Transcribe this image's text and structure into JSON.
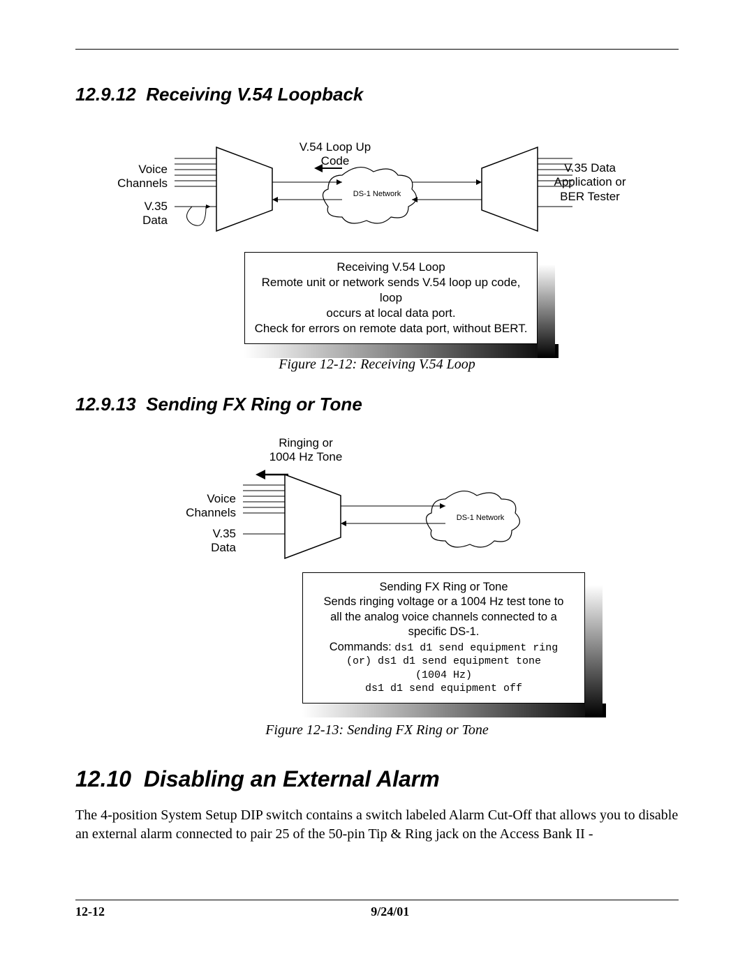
{
  "sections": {
    "s1_num": "12.9.12",
    "s1_title": "Receiving V.54 Loopback",
    "s2_num": "12.9.13",
    "s2_title": "Sending FX Ring or Tone",
    "h1_num": "12.10",
    "h1_title": "Disabling an External Alarm"
  },
  "fig1": {
    "caption": "Figure 12-12: Receiving V.54 Loop",
    "labels": {
      "voice": "Voice",
      "channels": "Channels",
      "v35": "V.35",
      "data": "Data",
      "loopup1": "V.54 Loop Up",
      "loopup2": "Code",
      "cloud": "DS-1 Network",
      "right1": "V.35 Data",
      "right2": "Application or",
      "right3": "BER Tester"
    },
    "box": {
      "l1": "Receiving V.54 Loop",
      "l2": "Remote unit or network sends V.54 loop up code, loop",
      "l3": "occurs at local data port.",
      "l4": "Check for errors on remote data port, without BERT."
    }
  },
  "fig2": {
    "caption": "Figure 12-13: Sending FX Ring or Tone",
    "labels": {
      "ring1": "Ringing or",
      "ring2": "1004 Hz Tone",
      "voice": "Voice",
      "channels": "Channels",
      "v35": "V.35",
      "data": "Data",
      "cloud": "DS-1 Network"
    },
    "box": {
      "l1": "Sending FX Ring or Tone",
      "l2": "Sends ringing voltage or a 1004 Hz test tone to",
      "l3": "all the analog voice channels connected to a",
      "l4": "specific DS-1.",
      "l5a": "Commands:",
      "l5b": "ds1 d1 send equipment ring",
      "l6": "(or) ds1 d1 send equipment tone",
      "l7": "(1004 Hz)",
      "l8": "ds1 d1 send equipment off"
    }
  },
  "para": "The 4-position System Setup DIP switch contains a switch labeled Alarm Cut-Off that allows you to disable an external alarm connected to pair 25 of the 50-pin Tip & Ring jack on the Access Bank II -",
  "footer": {
    "page": "12-12",
    "date": "9/24/01"
  }
}
